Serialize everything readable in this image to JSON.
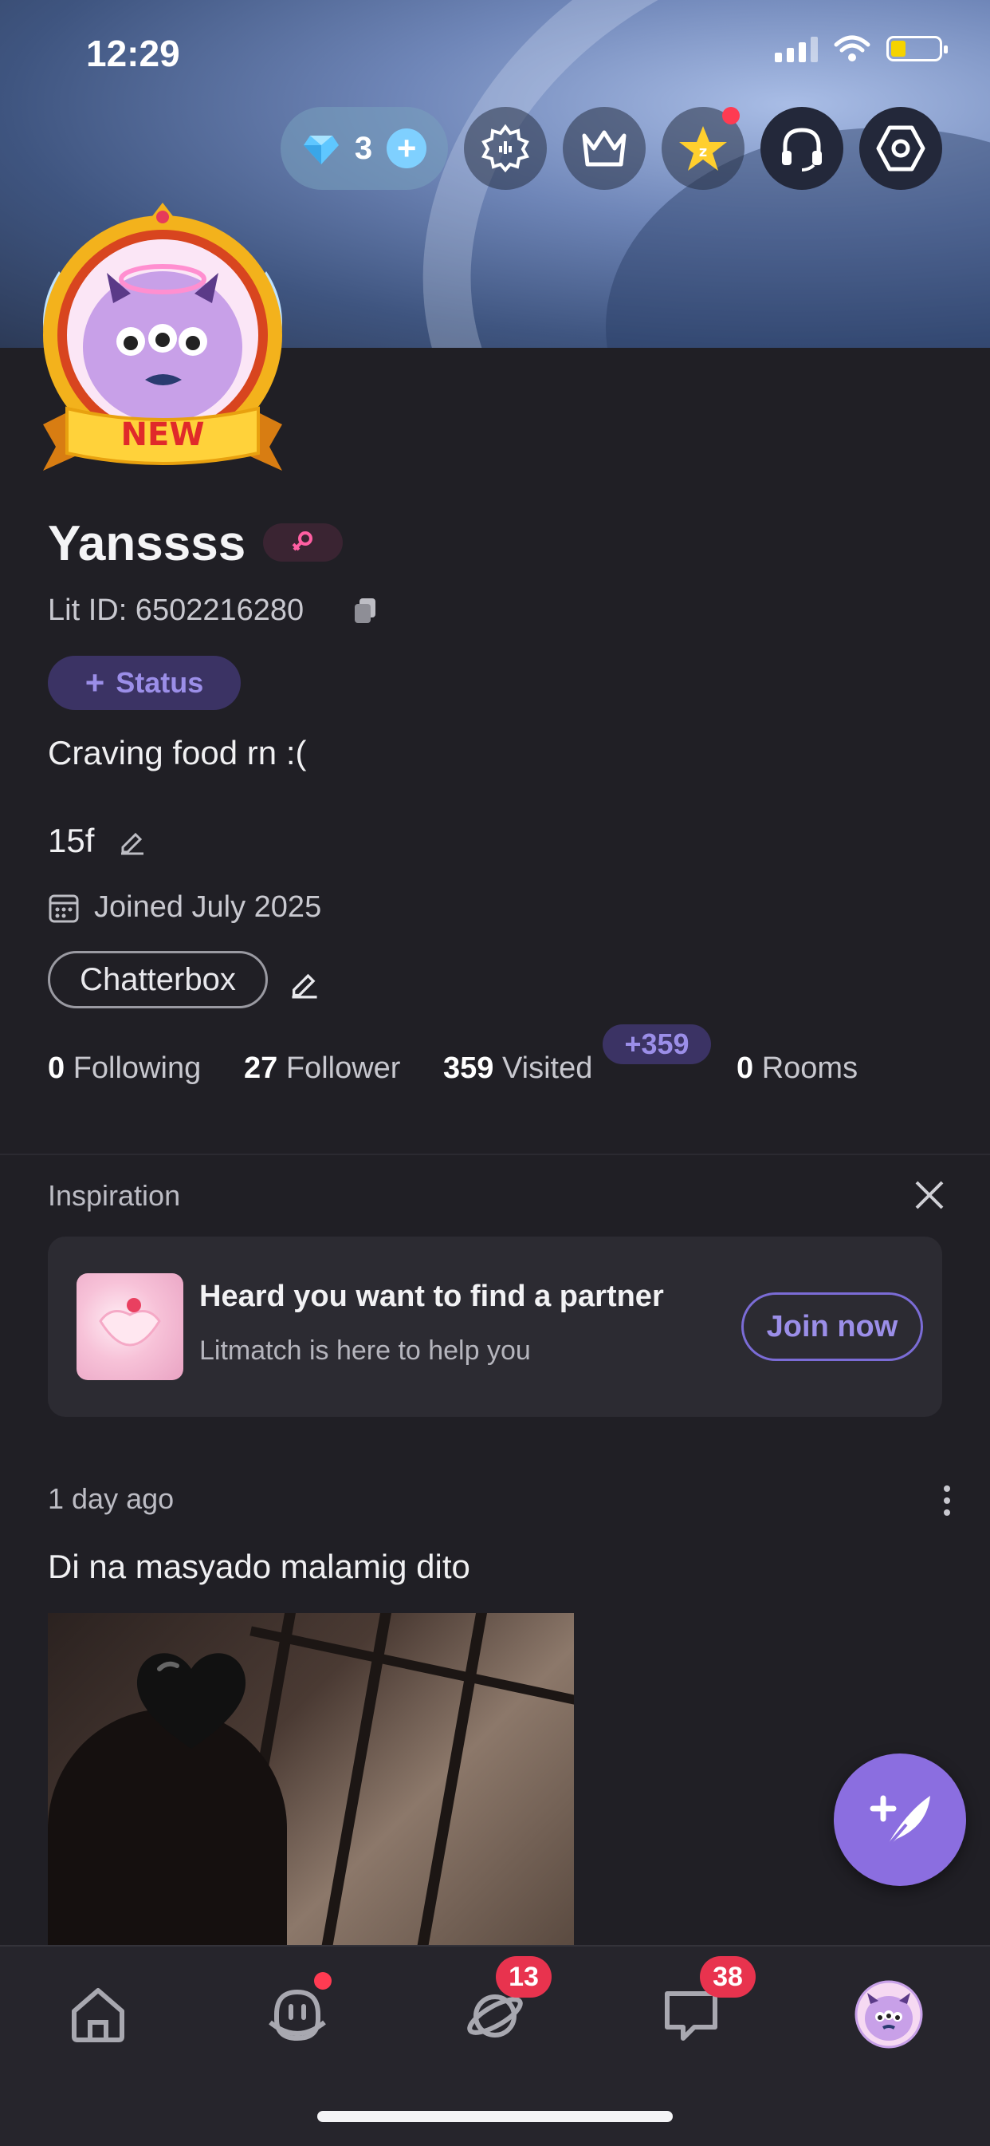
{
  "status_bar": {
    "time": "12:29"
  },
  "header": {
    "diamonds_count": "3"
  },
  "profile": {
    "badge_text": "NEW",
    "name": "Yanssss",
    "lit_id": "Lit ID: 6502216280",
    "status_button": "Status",
    "bio": "Craving food rn :(",
    "age_text": "15f",
    "joined": "Joined July 2025",
    "tag": "Chatterbox"
  },
  "stats": {
    "following_count": "0",
    "following_label": "Following",
    "follower_count": "27",
    "follower_label": "Follower",
    "visited_count": "359",
    "visited_label": "Visited",
    "visited_delta": "+359",
    "rooms_count": "0",
    "rooms_label": "Rooms"
  },
  "inspiration": {
    "title": "Inspiration",
    "card_title": "Heard you want to find a partner",
    "card_subtitle": "Litmatch is here to help you",
    "join_label": "Join now"
  },
  "post": {
    "time": "1 day ago",
    "text": "Di na masyado malamig dito"
  },
  "tabbar": {
    "items": [
      "home-icon",
      "match-icon",
      "planet-icon",
      "chat-icon",
      "profile-avatar"
    ],
    "planet_badge": "13",
    "chat_badge": "38"
  },
  "colors": {
    "accent": "#8b6ee0",
    "badge_red": "#e8334e",
    "background": "#201f25"
  }
}
